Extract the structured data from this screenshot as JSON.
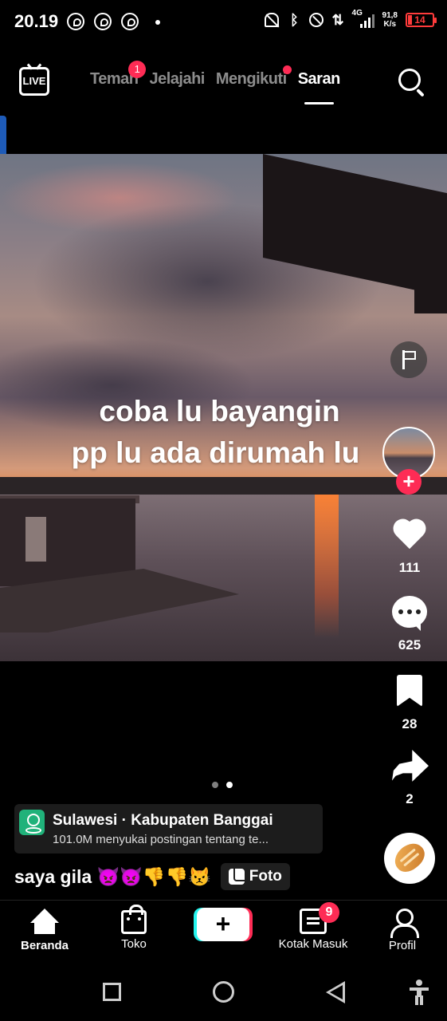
{
  "status_bar": {
    "time": "20.19",
    "network": "4G",
    "speed_value": "91,8",
    "speed_unit": "K/s",
    "battery": "14",
    "notification_apps": [
      "whatsapp-icon",
      "whatsapp-icon",
      "whatsapp-icon"
    ],
    "battery_color": "#ff3b3b"
  },
  "top_nav": {
    "live_label": "LIVE",
    "tabs": [
      {
        "label": "Teman",
        "badge": "1"
      },
      {
        "label": "Jelajahi"
      },
      {
        "label": "Mengikuti",
        "has_dot": true
      },
      {
        "label": "Saran",
        "active": true
      }
    ]
  },
  "post": {
    "overlay_text": [
      "coba lu bayangin",
      "pp lu ada dirumah lu"
    ],
    "likes": "111",
    "comments": "625",
    "saves": "28",
    "shares": "2",
    "pager": {
      "pages": 2,
      "current": 2
    },
    "location": {
      "title": "Sulawesi · Kabupaten Banggai",
      "subtitle": "101.0M menyukai postingan tentang te..."
    },
    "caption": "saya gila 👿👿👎👎😾",
    "foto_label": "Foto",
    "sound_icon": "bread-icon"
  },
  "bottom_nav": {
    "home": "Beranda",
    "shop": "Toko",
    "create": "+",
    "inbox": "Kotak Masuk",
    "inbox_badge": "9",
    "profile": "Profil"
  },
  "colors": {
    "accent": "#fe2c55",
    "cyan": "#25f4ee",
    "location_icon": "#20b27a"
  }
}
